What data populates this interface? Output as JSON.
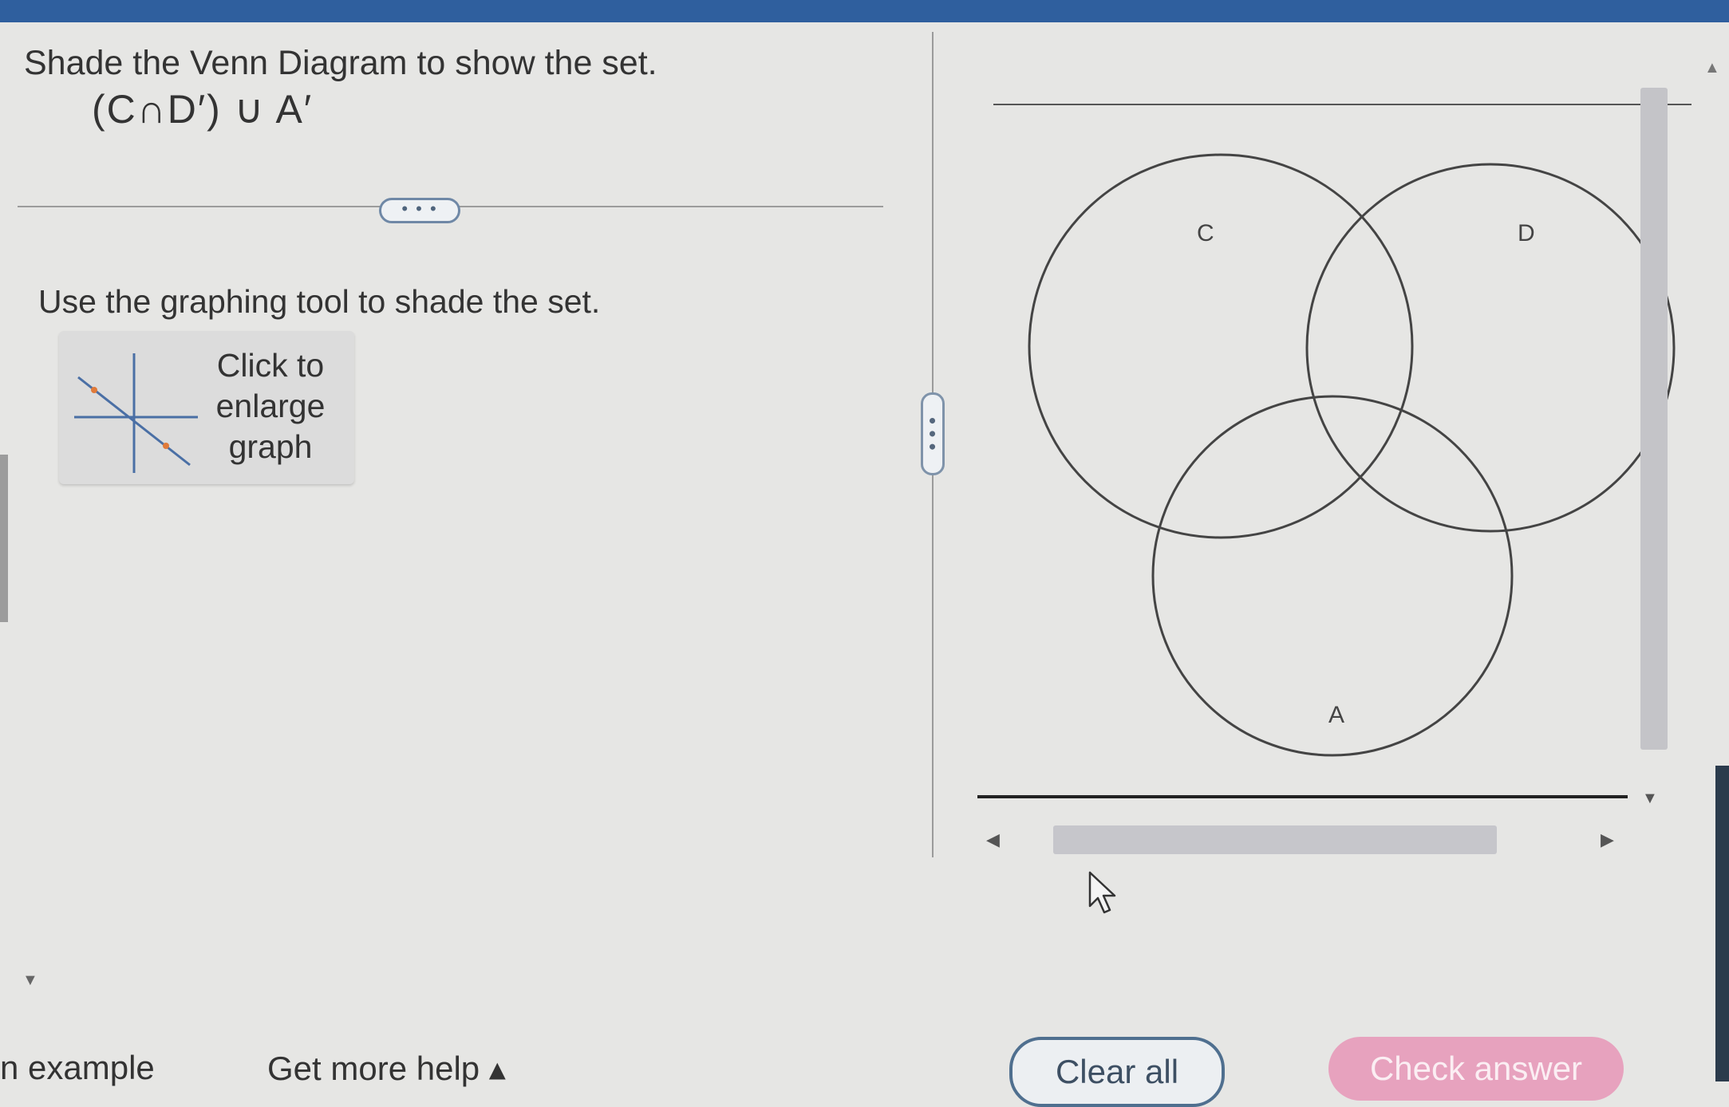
{
  "question": {
    "title": "Shade the Venn Diagram to show the set.",
    "set_expression": "(C∩D′) ∪ A′",
    "more_indicator": "• • •",
    "instruction": "Use the graphing tool to shade the set.",
    "enlarge_label_lines": [
      "Click to",
      "enlarge",
      "graph"
    ]
  },
  "divider": {
    "handle_glyph": "• • •"
  },
  "venn": {
    "sets": [
      {
        "label": "C"
      },
      {
        "label": "D"
      },
      {
        "label": "A"
      }
    ],
    "shaded_regions": []
  },
  "footer": {
    "example_link": "n example",
    "help_link": "Get more help ▴",
    "clear_button": "Clear all",
    "check_button": "Check answer"
  },
  "colors": {
    "topbar": "#2f5f9e",
    "check_button_bg": "#e7a2be",
    "clear_button_border": "#4f6f8f"
  }
}
